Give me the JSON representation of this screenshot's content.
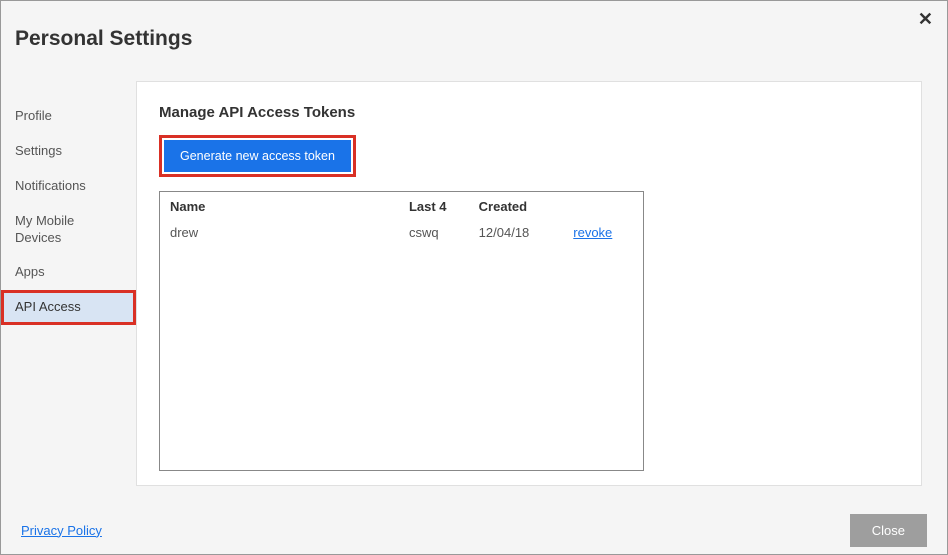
{
  "header": {
    "title": "Personal Settings",
    "close_symbol": "✕"
  },
  "sidebar": {
    "items": [
      {
        "label": "Profile",
        "active": false
      },
      {
        "label": "Settings",
        "active": false
      },
      {
        "label": "Notifications",
        "active": false
      },
      {
        "label": "My Mobile Devices",
        "active": false
      },
      {
        "label": "Apps",
        "active": false
      },
      {
        "label": "API Access",
        "active": true,
        "highlighted": true
      }
    ]
  },
  "main": {
    "panel_title": "Manage API Access Tokens",
    "generate_button_label": "Generate new access token",
    "table": {
      "headers": {
        "name": "Name",
        "last4": "Last 4",
        "created": "Created"
      },
      "rows": [
        {
          "name": "drew",
          "last4": "cswq",
          "created": "12/04/18",
          "action": "revoke"
        }
      ]
    }
  },
  "footer": {
    "privacy_label": "Privacy Policy",
    "close_label": "Close"
  }
}
